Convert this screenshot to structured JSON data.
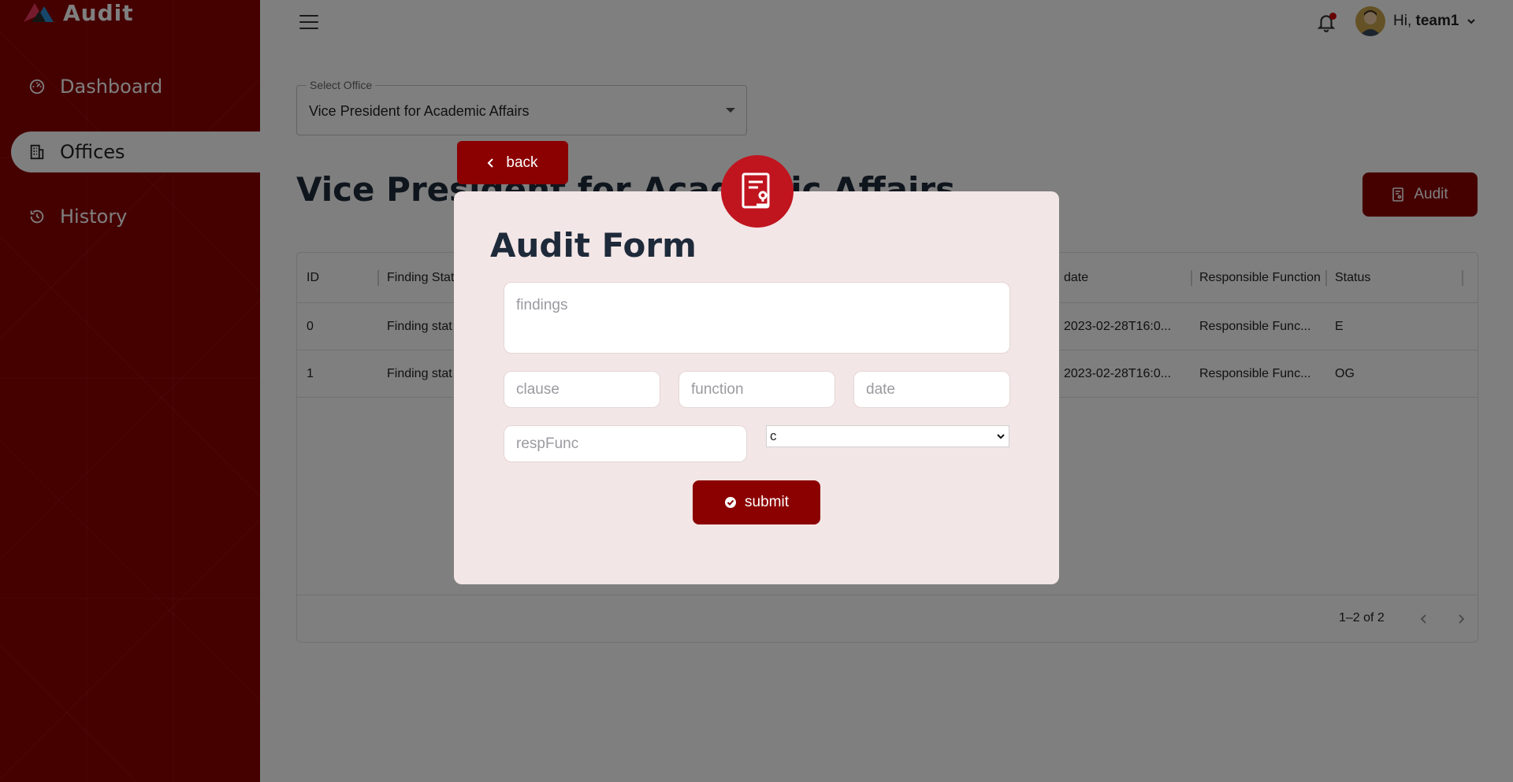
{
  "app": {
    "name": "Audit",
    "brand_color": "#8b0000"
  },
  "sidebar": {
    "items": [
      {
        "label": "Dashboard",
        "icon": "dashboard-gauge-icon"
      },
      {
        "label": "Offices",
        "icon": "building-icon",
        "active": true
      },
      {
        "label": "History",
        "icon": "history-icon"
      }
    ]
  },
  "header": {
    "greeting_prefix": "Hi,",
    "username": "team1"
  },
  "office_select": {
    "label": "Select Office",
    "value": "Vice President for Academic Affairs"
  },
  "page": {
    "title": "Vice President for Academic Affairs",
    "audit_button": "Audit"
  },
  "grid": {
    "columns": [
      "ID",
      "Finding Statement",
      "date",
      "Responsible Function",
      "Status"
    ],
    "rows": [
      {
        "id": "0",
        "finding": "Finding stat",
        "date": "2023-02-28T16:0...",
        "resp": "Responsible Func...",
        "status": "E"
      },
      {
        "id": "1",
        "finding": "Finding stat",
        "date": "2023-02-28T16:0...",
        "resp": "Responsible Func...",
        "status": "OG"
      }
    ],
    "pagination": "1–2 of 2"
  },
  "modal": {
    "title": "Audit Form",
    "back_label": "back",
    "findings_placeholder": "findings",
    "clause_placeholder": "clause",
    "function_placeholder": "function",
    "date_placeholder": "date",
    "respfunc_placeholder": "respFunc",
    "select_value": "c",
    "submit_label": "submit"
  }
}
